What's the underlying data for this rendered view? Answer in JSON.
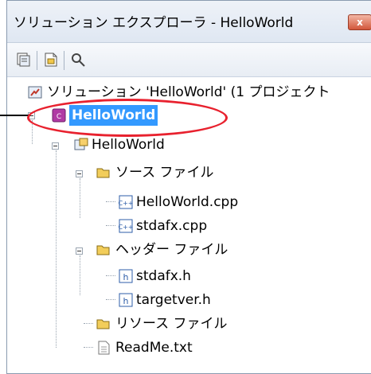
{
  "window": {
    "title": "ソリューション エクスプローラ - HelloWorld",
    "close_glyph": "x"
  },
  "toolbar": {
    "buttons": [
      "properties-icon",
      "show-all-files-icon",
      "view-code-icon"
    ]
  },
  "tree": {
    "solution_label": "ソリューション 'HelloWorld' (1 プロジェクト",
    "selected_project_label": "HelloWorld",
    "project_label": "HelloWorld",
    "source_folder_label": "ソース ファイル",
    "source_file_1": "HelloWorld.cpp",
    "source_file_2": "stdafx.cpp",
    "header_folder_label": "ヘッダー ファイル",
    "header_file_1": "stdafx.h",
    "header_file_2": "targetver.h",
    "resource_folder_label": "リソース ファイル",
    "readme_label": "ReadMe.txt"
  },
  "colors": {
    "selection": "#3399ff",
    "highlight": "#e8212e"
  }
}
